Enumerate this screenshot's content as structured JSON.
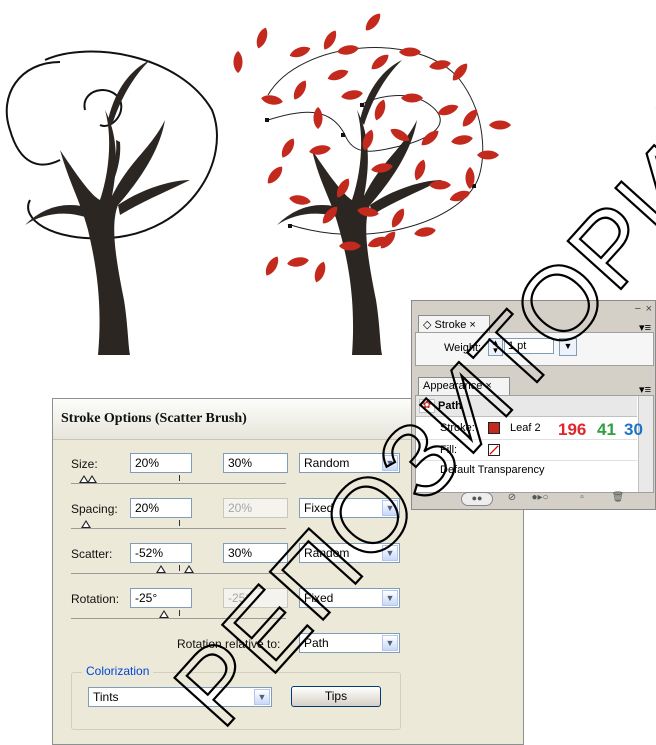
{
  "stroke_options_dialog": {
    "title": "Stroke Options (Scatter Brush)",
    "size": {
      "label": "Size:",
      "min": "20%",
      "max": "30%",
      "mode": "Random"
    },
    "spacing": {
      "label": "Spacing:",
      "min": "20%",
      "max": "20%",
      "mode": "Fixed"
    },
    "scatter": {
      "label": "Scatter:",
      "min": "-52%",
      "max": "30%",
      "mode": "Random"
    },
    "rotation": {
      "label": "Rotation:",
      "min": "-25°",
      "max": "-25°",
      "mode": "Fixed"
    },
    "rotation_relative_to": {
      "label": "Rotation relative to:",
      "value": "Path"
    },
    "colorization": {
      "legend": "Colorization",
      "method": "Tints",
      "tips_button": "Tips"
    }
  },
  "stroke_panel": {
    "tab": "Stroke",
    "weight_label": "Weight:",
    "weight_value": "1 pt"
  },
  "appearance_panel": {
    "tab": "Appearance",
    "object": "Path",
    "stroke_label": "Stroke:",
    "stroke_name": "Leaf 2",
    "fill_label": "Fill:",
    "default_transparency": "Default Transparency",
    "rgb": {
      "r": "196",
      "g": "41",
      "b": "30"
    }
  },
  "watermark": "РЕПОЗИТОРИЙ",
  "colors": {
    "leaf_red": "#c4291e",
    "trunk": "#2b2622",
    "rgb_r": "#e0262a",
    "rgb_g": "#2ea03c",
    "rgb_b": "#1e73c2",
    "dialog_bg": "#ece9d8"
  }
}
